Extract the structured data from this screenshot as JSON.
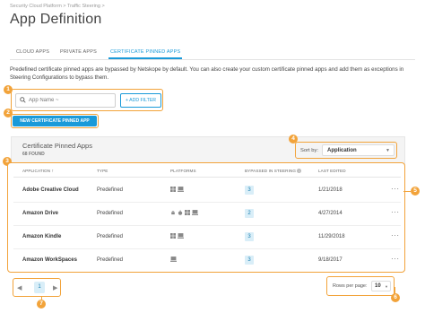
{
  "breadcrumb": "Security Cloud Platform > Traffic Steering >",
  "page_title": "App Definition",
  "tabs": [
    {
      "label": "CLOUD APPS",
      "active": false
    },
    {
      "label": "PRIVATE APPS",
      "active": false
    },
    {
      "label": "CERTIFICATE PINNED APPS",
      "active": true
    }
  ],
  "description": "Predefined certificate pinned apps are bypassed by Netskope by default. You can also create your custom certificate pinned apps and add them as exceptions in Steering Configurations to bypass them.",
  "search": {
    "placeholder": "App Name ~",
    "icon": "search-icon"
  },
  "add_filter_label": "+ ADD FILTER",
  "new_button_label": "NEW CERTIFICATE PINNED APP",
  "panel": {
    "title": "Certificate Pinned Apps",
    "count": "68 FOUND"
  },
  "sort": {
    "label": "Sort by:",
    "value": "Application"
  },
  "columns": {
    "application": "APPLICATION",
    "type": "TYPE",
    "platforms": "PLATFORMS",
    "bypassed": "BYPASSED IN STEERING",
    "last_edited": "LAST EDITED"
  },
  "rows": [
    {
      "name": "Adobe Creative Cloud",
      "type": "Predefined",
      "platforms": [
        "windows-icon",
        "mac-icon"
      ],
      "bypassed": "3",
      "last_edited": "1/21/2018"
    },
    {
      "name": "Amazon Drive",
      "type": "Predefined",
      "platforms": [
        "android-icon",
        "apple-icon",
        "windows-icon",
        "mac-icon"
      ],
      "bypassed": "2",
      "last_edited": "4/27/2014"
    },
    {
      "name": "Amazon Kindle",
      "type": "Predefined",
      "platforms": [
        "windows-icon",
        "mac-icon"
      ],
      "bypassed": "3",
      "last_edited": "11/29/2018"
    },
    {
      "name": "Amazon WorkSpaces",
      "type": "Predefined",
      "platforms": [
        "mac-icon"
      ],
      "bypassed": "3",
      "last_edited": "9/18/2017"
    }
  ],
  "pagination": {
    "current_page": "1"
  },
  "rows_per_page": {
    "label": "Rows per page:",
    "value": "10"
  },
  "markers": [
    "1",
    "2",
    "3",
    "4",
    "5",
    "6",
    "7"
  ],
  "colors": {
    "accent": "#1a9ad9",
    "callout": "#f2a33a",
    "badge_bg": "#d9eef8"
  }
}
